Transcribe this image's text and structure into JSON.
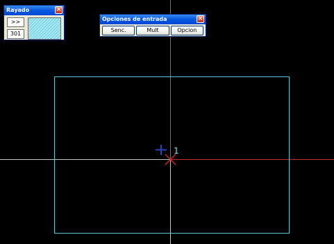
{
  "canvas": {
    "background_color": "#000000",
    "rectangle_color": "#5fc8d0",
    "y_axis_color": "#2f9a3c",
    "x_axis_color": "#c8282e",
    "crosshair_color": "#c8c8c8",
    "ucs_marker_color": "#2b3fb8",
    "origin_cross_color": "#c8282e",
    "point_label": "1"
  },
  "rayado": {
    "title": "Rayado",
    "next_label": ">>",
    "pattern_code": "301",
    "close_icon": "close-icon",
    "preview_color": "#7fd6e6"
  },
  "opciones": {
    "title": "Opciones de entrada",
    "close_icon": "close-icon",
    "buttons": [
      {
        "label": "Senc."
      },
      {
        "label": "Mult"
      },
      {
        "label": "Opcion"
      }
    ]
  }
}
